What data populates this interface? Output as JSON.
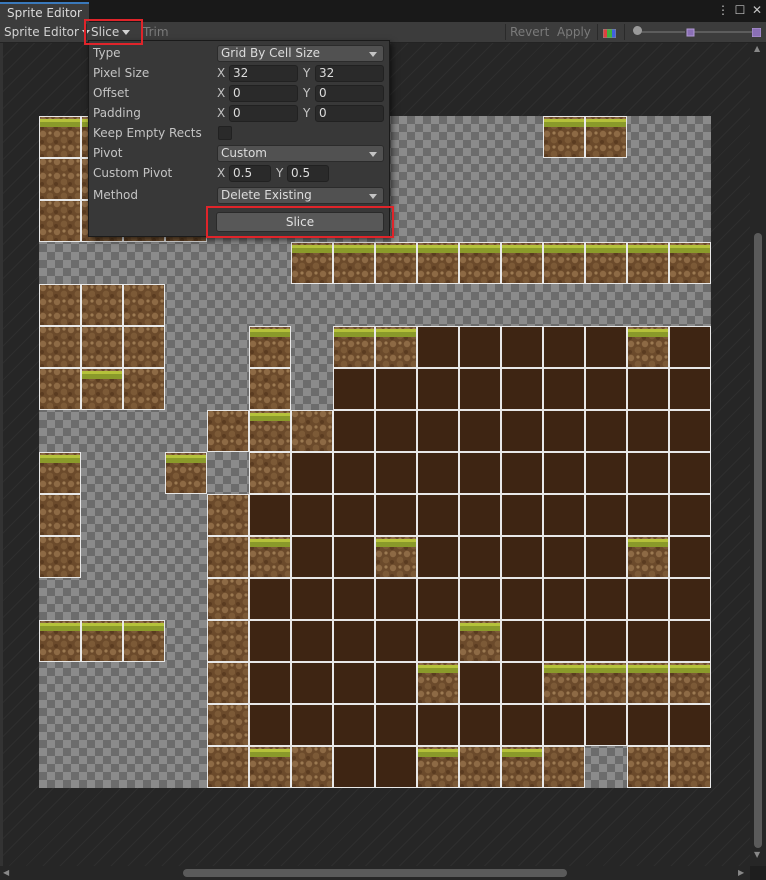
{
  "window": {
    "tab_title": "Sprite Editor"
  },
  "toolbar": {
    "mode_label": "Sprite Editor",
    "slice_label": "Slice",
    "trim_label": "Trim",
    "revert_label": "Revert",
    "apply_label": "Apply",
    "alpha_slider_value": 0.05,
    "mip_slider_value": 0.85
  },
  "slice_panel": {
    "type_label": "Type",
    "type_value": "Grid By Cell Size",
    "pixel_size_label": "Pixel Size",
    "pixel_size_x": "32",
    "pixel_size_y": "32",
    "offset_label": "Offset",
    "offset_x": "0",
    "offset_y": "0",
    "padding_label": "Padding",
    "padding_x": "0",
    "padding_y": "0",
    "keep_empty_label": "Keep Empty Rects",
    "keep_empty_checked": false,
    "pivot_label": "Pivot",
    "pivot_value": "Custom",
    "custom_pivot_label": "Custom Pivot",
    "custom_pivot_x": "0.5",
    "custom_pivot_y": "0.5",
    "method_label": "Method",
    "method_value": "Delete Existing",
    "slice_button_label": "Slice",
    "axis_x": "X",
    "axis_y": "Y"
  },
  "sprite_sheet": {
    "grid_columns": 16,
    "grid_rows": 16,
    "tiles": [
      "ggx.........gg..",
      "dd..............",
      "ddGG............",
      "......gggggggggg",
      "ddd...............",
      "ddd..G.ggDDDDDgD",
      "dgd..d.DDDDDDDDD",
      "....dgdDDDDDDDDD",
      "g..g.dDDDDDDDDDD",
      "d...dDDDDDDDDDDD",
      "d...dgDDgDDDDDgD",
      "....dDDDDDDDDDDD",
      "ggg.dDDDDDgDDDDD",
      "....dDDDDgDDgggg",
      "....dDDDDDDDDDDD",
      "....dgdDDgdgd.dd"
    ]
  }
}
